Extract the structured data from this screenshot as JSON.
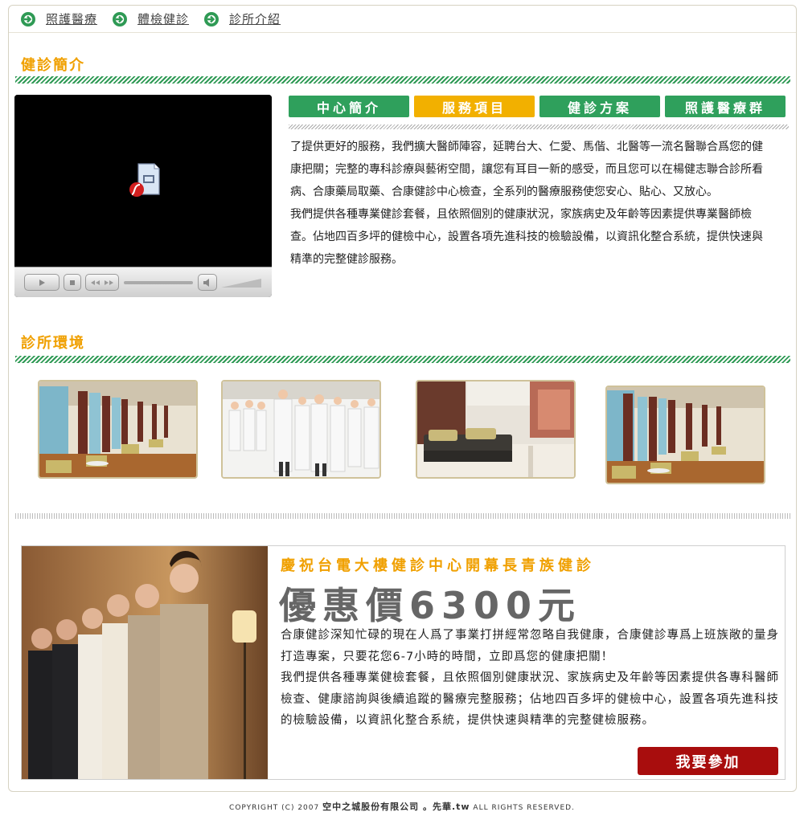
{
  "topnav": {
    "items": [
      {
        "label": "照護醫療",
        "icon": "arrow-right-circle-icon"
      },
      {
        "label": "體檢健診",
        "icon": "arrow-right-circle-icon"
      },
      {
        "label": "診所介紹",
        "icon": "arrow-right-circle-icon"
      }
    ]
  },
  "sections": {
    "intro_title": "健診簡介",
    "env_title": "診所環境"
  },
  "tabs": [
    {
      "label": "中心簡介",
      "color": "#2fa05c"
    },
    {
      "label": "服務項目",
      "color": "#f2b000"
    },
    {
      "label": "健診方案",
      "color": "#2fa05c"
    },
    {
      "label": "照護醫療群",
      "color": "#2fa05c"
    }
  ],
  "intro": {
    "paragraph1": "了提供更好的服務，我們擴大醫師陣容，延聘台大、仁愛、馬偕、北醫等一流名醫聯合爲您的健康把關；完整的專科診療與藝術空間，讓您有耳目一新的感受，而且您可以在楊健志聯合診所看病、合康藥局取藥、合康健診中心檢查，全系列的醫療服務使您安心、貼心、又放心。",
    "paragraph2": "我們提供各種專業健診套餐，且依照個別的健康狀況，家族病史及年齡等因素提供專業醫師檢查。佔地四百多坪的健檢中心，設置各項先進科技的檢驗設備，以資訊化整合系統，提供快速與精準的完整健診服務。"
  },
  "video": {
    "plugin_icon": "flash-plugin-missing-icon"
  },
  "gallery": [
    {
      "name": "lounge-photo"
    },
    {
      "name": "medical-team-photo"
    },
    {
      "name": "waiting-room-photo"
    },
    {
      "name": "lounge-photo-2"
    }
  ],
  "promo": {
    "title": "慶祝台電大樓健診中心開幕長青族健診",
    "price": "優惠價6300元",
    "body1": "合康健診深知忙碌的現在人爲了事業打拼經常忽略自我健康，合康健診專爲上班族敞的量身打造專案，只要花您6-7小時的時間，立即爲您的健康把關！",
    "body2": "我們提供各種專業健檢套餐，且依照個別健康狀況、家族病史及年齡等因素提供各專科醫師檢查、健康諮詢與後續追蹤的醫療完整服務；佔地四百多坪的健檢中心，設置各項先進科技的檢驗設備，以資訊化整合系統，提供快速與精準的完整健檢服務。",
    "button": "我要參加"
  },
  "footer": {
    "prefix": "COPYRIGHT (C) 2007",
    "company": "空中之城股份有限公司 。先華.tw",
    "suffix": "ALL RIGHTS RESERVED."
  }
}
